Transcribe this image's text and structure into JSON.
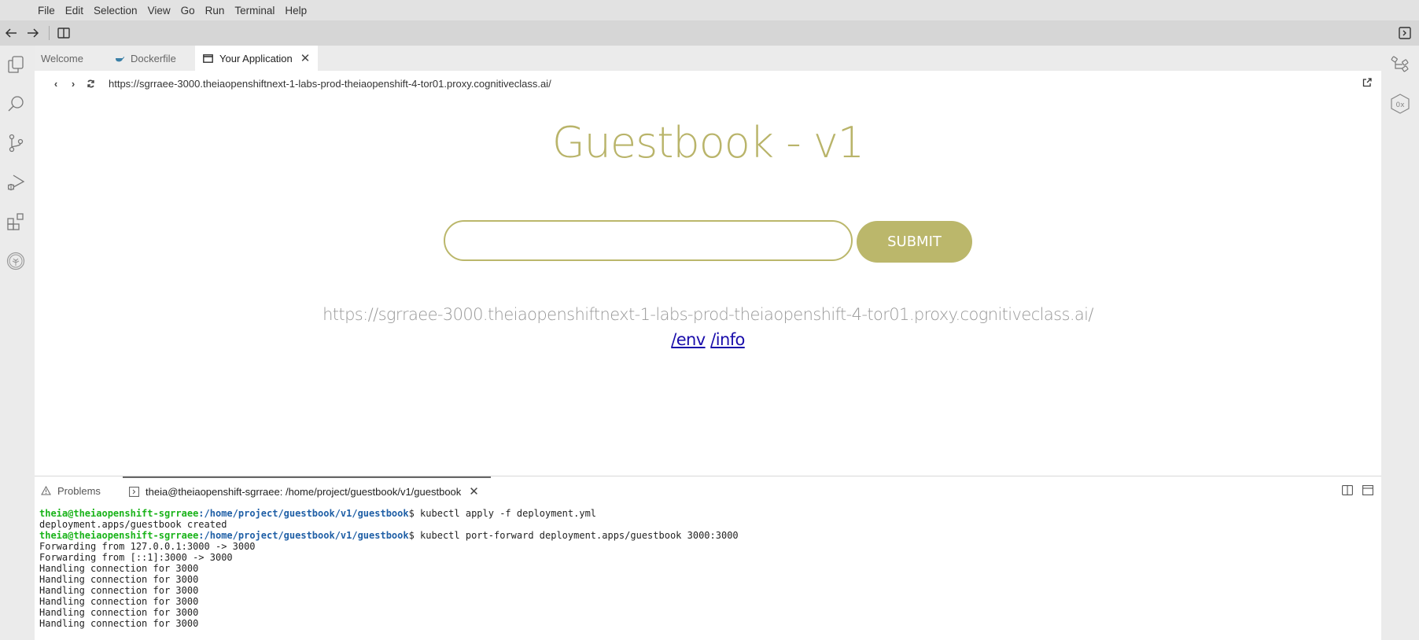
{
  "menubar": {
    "items": [
      "File",
      "Edit",
      "Selection",
      "View",
      "Go",
      "Run",
      "Terminal",
      "Help"
    ]
  },
  "toolbar": {
    "icons": [
      "arrow-left-icon",
      "arrow-right-icon",
      "split-editor-icon",
      "toggle-panel-icon"
    ]
  },
  "activity_bar": {
    "items": [
      "explorer",
      "search",
      "source-control",
      "run-debug",
      "extensions",
      "skills-network"
    ]
  },
  "right_bar": {
    "items": [
      "outline",
      "memory-inspector"
    ]
  },
  "tabs": [
    {
      "label": "Welcome",
      "icon": "none",
      "active": false
    },
    {
      "label": "Dockerfile",
      "icon": "docker-icon",
      "active": false
    },
    {
      "label": "Your Application",
      "icon": "browser-window-icon",
      "active": true,
      "closable": true
    }
  ],
  "browser": {
    "url": "https://sgrraee-3000.theiaopenshiftnext-1-labs-prod-theiaopenshift-4-tor01.proxy.cognitiveclass.ai/",
    "page": {
      "title": "Guestbook - v1",
      "input_value": "",
      "input_placeholder": "",
      "submit_label": "SUBMIT",
      "host_url": "https://sgrraee-3000.theiaopenshiftnext-1-labs-prod-theiaopenshift-4-tor01.proxy.cognitiveclass.ai/",
      "links": [
        "/env",
        "/info"
      ]
    },
    "colors": {
      "accent": "#bbb76b",
      "link": "#1a0dab",
      "host_text": "#999999"
    }
  },
  "panel": {
    "tabs": [
      {
        "label": "Problems",
        "icon": "warning-icon",
        "active": false
      },
      {
        "label": "theia@theiaopenshift-sgrraee: /home/project/guestbook/v1/guestbook",
        "icon": "terminal-icon",
        "active": true
      }
    ],
    "terminal": {
      "prompt_user": "theia@theiaopenshift-sgrraee",
      "prompt_path": ":/home/project/guestbook/v1/guestbook",
      "lines": [
        {
          "type": "prompt",
          "cmd": "$ kubectl apply -f deployment.yml"
        },
        {
          "type": "out",
          "text": "deployment.apps/guestbook created"
        },
        {
          "type": "prompt",
          "cmd": "$ kubectl port-forward deployment.apps/guestbook 3000:3000"
        },
        {
          "type": "out",
          "text": "Forwarding from 127.0.0.1:3000 -> 3000"
        },
        {
          "type": "out",
          "text": "Forwarding from [::1]:3000 -> 3000"
        },
        {
          "type": "out",
          "text": "Handling connection for 3000"
        },
        {
          "type": "out",
          "text": "Handling connection for 3000"
        },
        {
          "type": "out",
          "text": "Handling connection for 3000"
        },
        {
          "type": "out",
          "text": "Handling connection for 3000"
        },
        {
          "type": "out",
          "text": "Handling connection for 3000"
        },
        {
          "type": "out",
          "text": "Handling connection for 3000"
        }
      ]
    }
  }
}
